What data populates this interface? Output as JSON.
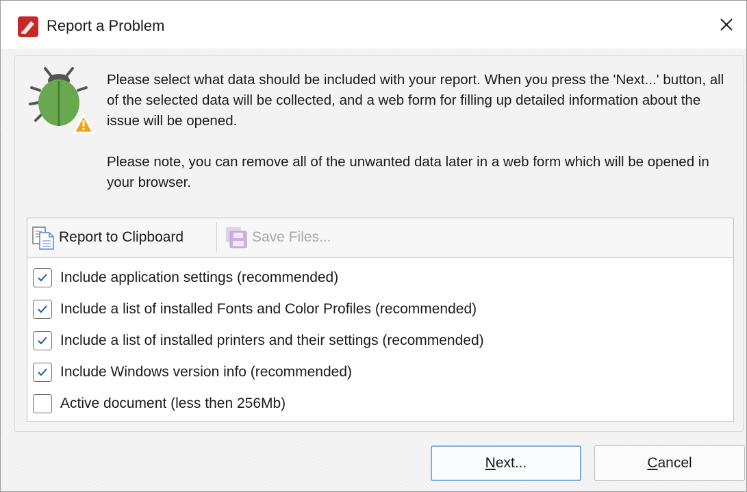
{
  "window": {
    "title": "Report a Problem"
  },
  "intro": {
    "paragraph1": "Please select what data should be included with your report. When you press the 'Next...' button, all of the selected data will be collected, and a web form for filling up detailed information about the issue will be opened.",
    "paragraph2": "Please note, you can remove all of the unwanted data later in a web form which will be opened in your browser."
  },
  "toolbar": {
    "clipboard_label": "Report to Clipboard",
    "save_label": "Save Files..."
  },
  "checks": [
    {
      "label": "Include application settings (recommended)",
      "checked": true
    },
    {
      "label": "Include a list of installed Fonts and Color Profiles (recommended)",
      "checked": true
    },
    {
      "label": "Include a list of installed printers and their settings (recommended)",
      "checked": true
    },
    {
      "label": "Include Windows version info (recommended)",
      "checked": true
    },
    {
      "label": "Active document (less then 256Mb)",
      "checked": false
    }
  ],
  "buttons": {
    "next_label": "Next...",
    "cancel_label": "Cancel"
  },
  "colors": {
    "accent": "#2b6cb0",
    "bug_green": "#6aa84f",
    "warning_orange": "#f4a20c",
    "app_red": "#c62828"
  }
}
